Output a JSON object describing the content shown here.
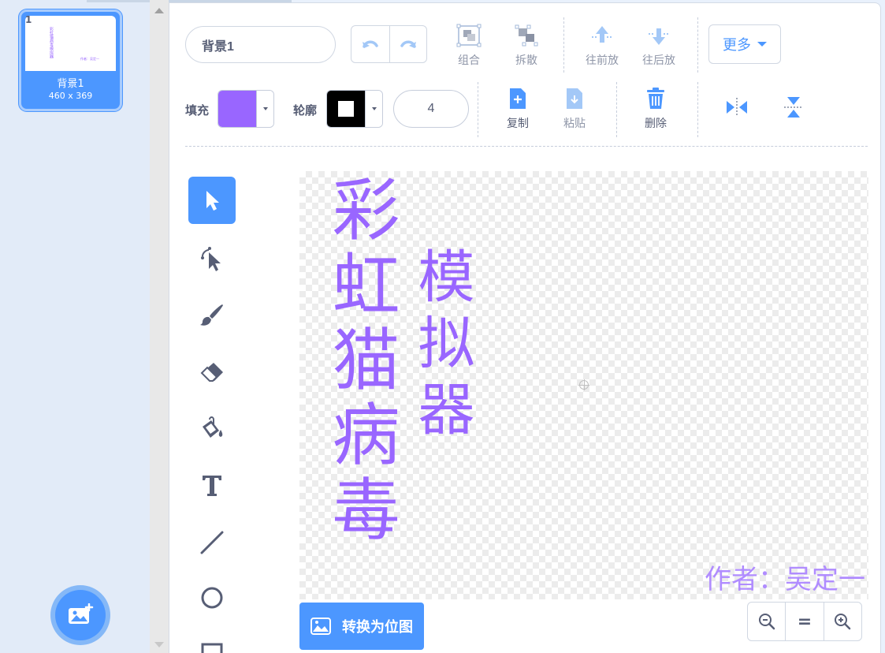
{
  "costume": {
    "number": "1",
    "name": "背景1",
    "size": "460 x 369",
    "thumb_title": "彩虹猫病毒模拟器",
    "thumb_author": "作者：吴定一"
  },
  "toolbar": {
    "costume_name_value": "背景1",
    "group_label": "组合",
    "ungroup_label": "拆散",
    "forward_label": "往前放",
    "backward_label": "往后放",
    "more_label": "更多",
    "fill_label": "填充",
    "outline_label": "轮廓",
    "outline_width": "4",
    "copy_label": "复制",
    "paste_label": "粘贴",
    "delete_label": "删除"
  },
  "colors": {
    "fill": "#9966ff",
    "outline": "#000000",
    "accent": "#4c97ff"
  },
  "tools": [
    "select-tool",
    "reshape-tool",
    "brush-tool",
    "eraser-tool",
    "fill-tool",
    "text-tool",
    "line-tool",
    "circle-tool",
    "rectangle-tool"
  ],
  "canvas": {
    "title_col1": "彩虹猫病毒",
    "title_col2": "模拟器",
    "author": "作者：吴定一"
  },
  "convert_button": "转换为位图",
  "zoom": {
    "out": "zoom-out",
    "reset": "=",
    "in": "zoom-in"
  }
}
